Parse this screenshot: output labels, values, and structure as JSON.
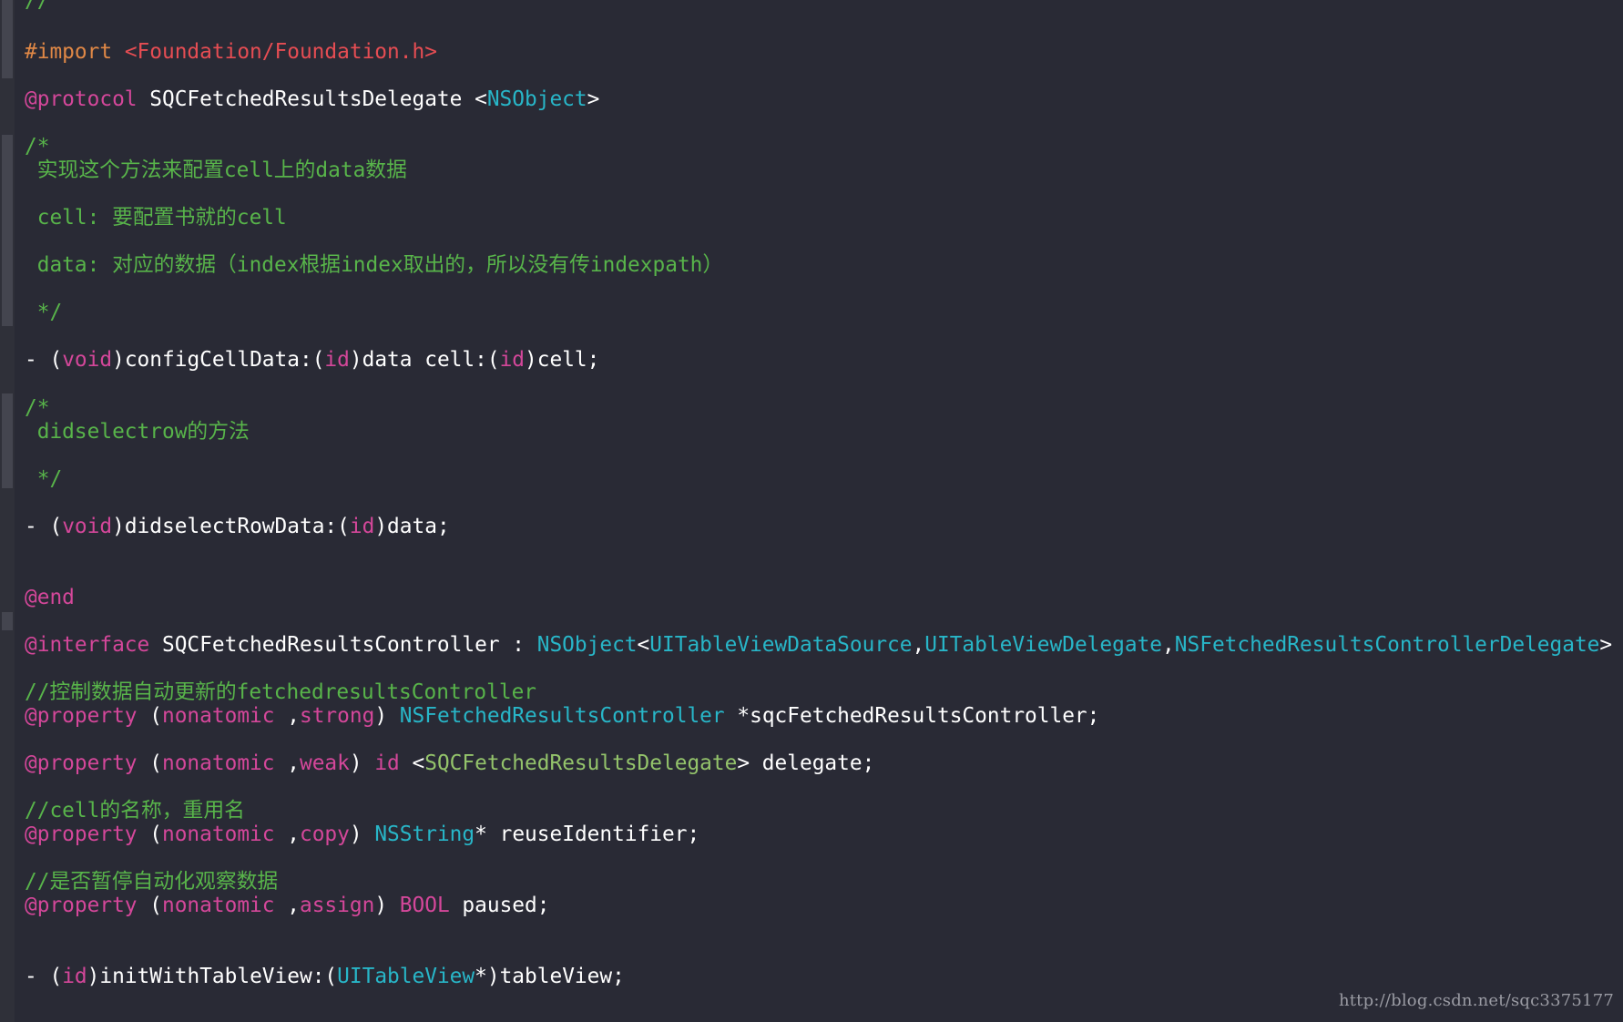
{
  "lines": [
    {
      "tokens": [
        {
          "t": "//",
          "c": "cm"
        }
      ]
    },
    {
      "tokens": [
        {
          "t": "#import ",
          "c": "pp"
        },
        {
          "t": "<Foundation/Foundation.h>",
          "c": "str"
        }
      ]
    },
    {
      "tokens": [
        {
          "t": "@protocol",
          "c": "kw"
        },
        {
          "t": " SQCFetchedResultsDelegate <",
          "c": "pl"
        },
        {
          "t": "NSObject",
          "c": "ty"
        },
        {
          "t": ">",
          "c": "pl"
        }
      ]
    },
    {
      "tokens": [
        {
          "t": "/*",
          "c": "cm"
        }
      ]
    },
    {
      "tokens": [
        {
          "t": " 实现这个方法来配置cell上的data数据",
          "c": "cm"
        }
      ]
    },
    {
      "tokens": [
        {
          "t": " cell: 要配置书就的cell",
          "c": "cm"
        }
      ]
    },
    {
      "tokens": [
        {
          "t": " data: 对应的数据（index根据index取出的，所以没有传indexpath）",
          "c": "cm"
        }
      ]
    },
    {
      "tokens": [
        {
          "t": " */",
          "c": "cm"
        }
      ]
    },
    {
      "tokens": [
        {
          "t": "- (",
          "c": "pl"
        },
        {
          "t": "void",
          "c": "kw"
        },
        {
          "t": ")configCellData:(",
          "c": "pl"
        },
        {
          "t": "id",
          "c": "kw"
        },
        {
          "t": ")data cell:(",
          "c": "pl"
        },
        {
          "t": "id",
          "c": "kw"
        },
        {
          "t": ")cell;",
          "c": "pl"
        }
      ]
    },
    {
      "tokens": [
        {
          "t": "/*",
          "c": "cm"
        }
      ]
    },
    {
      "tokens": [
        {
          "t": " didselectrow的方法",
          "c": "cm"
        }
      ]
    },
    {
      "tokens": [
        {
          "t": " */",
          "c": "cm"
        }
      ]
    },
    {
      "tokens": [
        {
          "t": "- (",
          "c": "pl"
        },
        {
          "t": "void",
          "c": "kw"
        },
        {
          "t": ")didselectRowData:(",
          "c": "pl"
        },
        {
          "t": "id",
          "c": "kw"
        },
        {
          "t": ")data;",
          "c": "pl"
        }
      ]
    },
    {
      "tokens": [
        {
          "t": "@end",
          "c": "kw"
        }
      ]
    },
    {
      "tokens": [
        {
          "t": "@interface",
          "c": "kw"
        },
        {
          "t": " SQCFetchedResultsController : ",
          "c": "pl"
        },
        {
          "t": "NSObject",
          "c": "ty"
        },
        {
          "t": "<",
          "c": "pl"
        },
        {
          "t": "UITableViewDataSource",
          "c": "ty"
        },
        {
          "t": ",",
          "c": "pl"
        },
        {
          "t": "UITableViewDelegate",
          "c": "ty"
        },
        {
          "t": ",",
          "c": "pl"
        },
        {
          "t": "NSFetchedResultsControllerDelegate",
          "c": "ty"
        },
        {
          "t": ">",
          "c": "pl"
        }
      ]
    },
    {
      "tokens": [
        {
          "t": "//控制数据自动更新的fetchedresultsController",
          "c": "cm"
        }
      ]
    },
    {
      "tokens": [
        {
          "t": "@property",
          "c": "kw"
        },
        {
          "t": " (",
          "c": "pl"
        },
        {
          "t": "nonatomic",
          "c": "kw"
        },
        {
          "t": " ,",
          "c": "pl"
        },
        {
          "t": "strong",
          "c": "kw"
        },
        {
          "t": ") ",
          "c": "pl"
        },
        {
          "t": "NSFetchedResultsController",
          "c": "ty"
        },
        {
          "t": " *sqcFetchedResultsController;",
          "c": "pl"
        }
      ]
    },
    {
      "tokens": [
        {
          "t": "@property",
          "c": "kw"
        },
        {
          "t": " (",
          "c": "pl"
        },
        {
          "t": "nonatomic",
          "c": "kw"
        },
        {
          "t": " ,",
          "c": "pl"
        },
        {
          "t": "weak",
          "c": "kw"
        },
        {
          "t": ") ",
          "c": "pl"
        },
        {
          "t": "id",
          "c": "kw"
        },
        {
          "t": " <",
          "c": "pl"
        },
        {
          "t": "SQCFetchedResultsDelegate",
          "c": "dtype"
        },
        {
          "t": "> delegate;",
          "c": "pl"
        }
      ]
    },
    {
      "tokens": [
        {
          "t": "//cell的名称，重用名",
          "c": "cm"
        }
      ]
    },
    {
      "tokens": [
        {
          "t": "@property",
          "c": "kw"
        },
        {
          "t": " (",
          "c": "pl"
        },
        {
          "t": "nonatomic",
          "c": "kw"
        },
        {
          "t": " ,",
          "c": "pl"
        },
        {
          "t": "copy",
          "c": "kw"
        },
        {
          "t": ") ",
          "c": "pl"
        },
        {
          "t": "NSString",
          "c": "ty"
        },
        {
          "t": "* reuseIdentifier;",
          "c": "pl"
        }
      ]
    },
    {
      "tokens": [
        {
          "t": "//是否暂停自动化观察数据",
          "c": "cm"
        }
      ]
    },
    {
      "tokens": [
        {
          "t": "@property",
          "c": "kw"
        },
        {
          "t": " (",
          "c": "pl"
        },
        {
          "t": "nonatomic",
          "c": "kw"
        },
        {
          "t": " ,",
          "c": "pl"
        },
        {
          "t": "assign",
          "c": "kw"
        },
        {
          "t": ") ",
          "c": "pl"
        },
        {
          "t": "BOOL",
          "c": "kw"
        },
        {
          "t": " paused;",
          "c": "pl"
        }
      ]
    },
    {
      "tokens": [
        {
          "t": "- (",
          "c": "pl"
        },
        {
          "t": "id",
          "c": "kw"
        },
        {
          "t": ")initWithTableView:(",
          "c": "pl"
        },
        {
          "t": "UITableView",
          "c": "ty"
        },
        {
          "t": "*)tableView;",
          "c": "pl"
        }
      ]
    }
  ],
  "watermark": "http://blog.csdn.net/sqc3375177",
  "colors": {
    "background": "#292a35",
    "keyword": "#d4479a",
    "preprocessor": "#e08846",
    "string": "#e64d53",
    "type": "#28b6c8",
    "comment": "#58b44a",
    "plain": "#ffffff"
  }
}
